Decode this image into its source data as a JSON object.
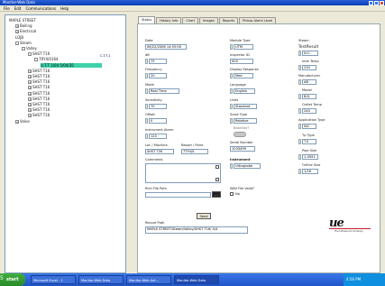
{
  "window": {
    "title": "Monitor-Web Data",
    "menu": [
      "File",
      "Edit",
      "Communications",
      "Help"
    ]
  },
  "tree": {
    "items": [
      {
        "label": "MAPLE STREET",
        "indent": 0,
        "expand": "",
        "selected": false
      },
      {
        "label": "Boiling",
        "indent": 1,
        "expand": "+",
        "selected": false
      },
      {
        "label": "Electrical",
        "indent": 1,
        "expand": "+",
        "selected": false
      },
      {
        "label": "LOJB",
        "indent": 1,
        "expand": "",
        "selected": false
      },
      {
        "label": "Steam",
        "indent": 1,
        "expand": "-",
        "selected": false
      },
      {
        "label": "Valley",
        "indent": 2,
        "expand": "-",
        "selected": false
      },
      {
        "label": "SHST T16",
        "indent": 3,
        "expand": "-",
        "selected": false
      },
      {
        "label": "7RY4/0164",
        "indent": 4,
        "expand": "-",
        "selected": false
      },
      {
        "label": "U.T.T 1/04 5/04/35",
        "indent": 5,
        "expand": "",
        "selected": true
      },
      {
        "label": "SHST T16",
        "indent": 3,
        "expand": "+",
        "selected": false
      },
      {
        "label": "SHST T16",
        "indent": 3,
        "expand": "+",
        "selected": false
      },
      {
        "label": "SHST T16",
        "indent": 3,
        "expand": "+",
        "selected": false
      },
      {
        "label": "SHST T16",
        "indent": 3,
        "expand": "+",
        "selected": false
      },
      {
        "label": "SHST T16",
        "indent": 3,
        "expand": "+",
        "selected": false
      },
      {
        "label": "SHST T16",
        "indent": 3,
        "expand": "+",
        "selected": false
      },
      {
        "label": "SHST T16",
        "indent": 3,
        "expand": "+",
        "selected": false
      },
      {
        "label": "SHST T16",
        "indent": 3,
        "expand": "+",
        "selected": false
      },
      {
        "label": "SHST T16",
        "indent": 3,
        "expand": "+",
        "selected": false
      },
      {
        "label": "Valve",
        "indent": 1,
        "expand": "+",
        "selected": false
      }
    ],
    "selected_code": "C.T.T.1"
  },
  "tabs": [
    "Status",
    "History Info",
    "Chart",
    "Images",
    "Reports",
    "Pickup Alarm Level"
  ],
  "details": {
    "date_label": "Date",
    "date_value": "06/22/2006 14:55:00",
    "db_label": "dB",
    "db_value": "75",
    "frequency_label": "Frequency",
    "frequency_value": "20",
    "mode_label": "Mode",
    "mode_value": "Real Time",
    "sensitivity_label": "Sensitivity",
    "sensitivity_value": "70",
    "offset_label": "Offset",
    "offset_value": "0",
    "alarm_label": "Instrument Alarm",
    "alarm_value": "120",
    "loc_label": "Loc / Machine",
    "loc_value": "SHST T/M",
    "report_point_label": "Report / Point",
    "report_point_value": "7TY4/0",
    "comments_label": "Comments",
    "rich_file_label": "Rich File Path",
    "rich_file_button": "...",
    "send_button": "Send",
    "record_path_label": "Record Path",
    "record_path_value": "MAPLE STREET/Steam/Valley/SHST T16/ 4/4",
    "module_type_label": "Module Type",
    "module_type_value": "UTM",
    "inspector_label": "Inspector ID",
    "inspector_value": "005",
    "display_response_label": "Display Response",
    "display_response_value": "Med",
    "language_label": "Language",
    "language_value": "English",
    "units_label": "Units",
    "units_value": "Standard",
    "scale_type_label": "Scale Type",
    "scale_type_value": "Relative",
    "baseline_label": "Baseline?",
    "serial_label": "Serial Number",
    "serial_value": "1033499",
    "instrument_label": "Instrument",
    "instrument_value": "Ultraprobe",
    "wav_label": "WAV File Valid?",
    "wav_value": "No",
    "steam_label": "Steam",
    "test_result_label": "TestResult",
    "test_result_value": "N.C.",
    "inlet_temp_label": "Inlet Temp",
    "inlet_temp_value": "230",
    "manufacturer_label": "Manufacturer",
    "manufacturer_value": "AB",
    "model_label": "Model",
    "model_value": "B/Q",
    "outlet_temp_label": "Outlet Temp",
    "outlet_temp_value": "240",
    "application_label": "Application Type",
    "application_value": "N/C",
    "trap_type_label": "Tp Type",
    "trap_type_value": "T.S",
    "pipe_size_label": "Pipe Size",
    "pipe_size_value": "1-0551",
    "orifice_label": "Orifice Size",
    "orifice_value": "1/16"
  },
  "logo": {
    "text": "ue",
    "subtitle": "The Ultrasound Company"
  },
  "taskbar": {
    "start_label": "start",
    "tasks": [
      "Microsoft Excel - 1",
      "Monitor-Web Data",
      "Monitor-Web Aut...",
      "Monitor-Web Data"
    ],
    "tray_time": "4:56 PM"
  },
  "corner_label": "5"
}
